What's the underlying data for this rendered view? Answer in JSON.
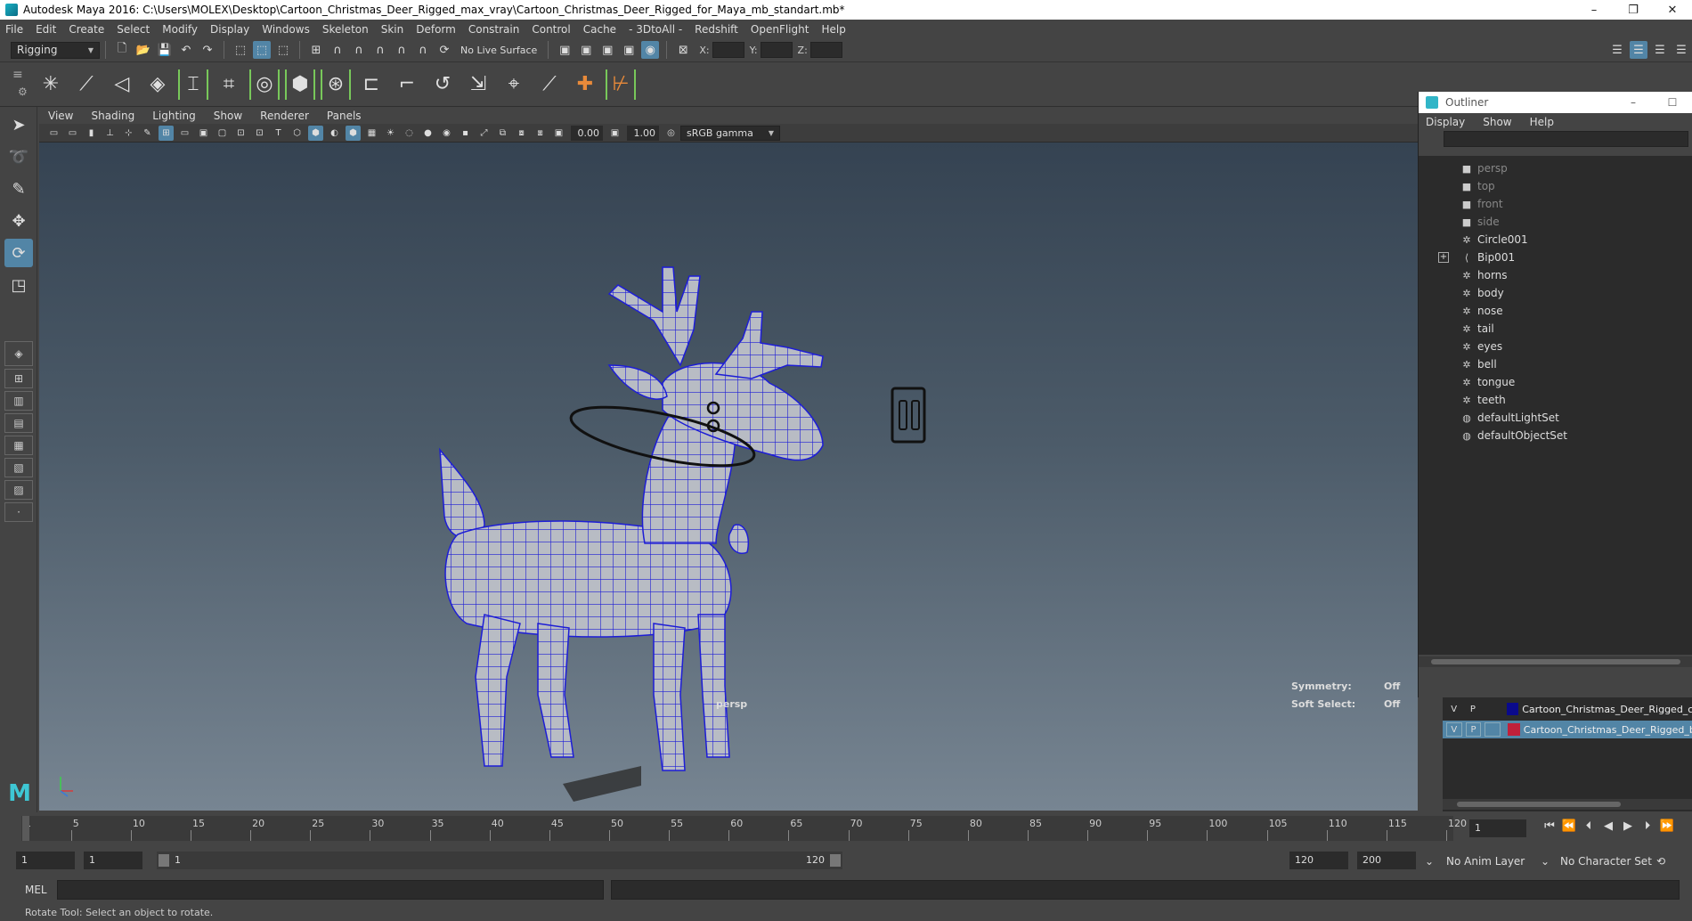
{
  "window": {
    "title": "Autodesk Maya 2016: C:\\Users\\MOLEX\\Desktop\\Cartoon_Christmas_Deer_Rigged_max_vray\\Cartoon_Christmas_Deer_Rigged_for_Maya_mb_standart.mb*",
    "minimize": "–",
    "restore": "❐",
    "close": "✕"
  },
  "menubar": [
    "File",
    "Edit",
    "Create",
    "Select",
    "Modify",
    "Display",
    "Windows",
    "Skeleton",
    "Skin",
    "Deform",
    "Constrain",
    "Control",
    "Cache",
    "- 3DtoAll -",
    "Redshift",
    "OpenFlight",
    "Help"
  ],
  "statusline": {
    "menuset": "Rigging",
    "live_surface": "No Live Surface",
    "x_label": "X:",
    "y_label": "Y:",
    "z_label": "Z:"
  },
  "viewport": {
    "menu": [
      "View",
      "Shading",
      "Lighting",
      "Show",
      "Renderer",
      "Panels"
    ],
    "exposure": "0.00",
    "gamma": "1.00",
    "color_space": "sRGB gamma",
    "camera": "persp",
    "hud": {
      "symmetry_label": "Symmetry:",
      "symmetry_value": "Off",
      "soft_select_label": "Soft Select:",
      "soft_select_value": "Off"
    }
  },
  "outliner": {
    "title": "Outliner",
    "menu": [
      "Display",
      "Show",
      "Help"
    ],
    "items": [
      {
        "label": "persp",
        "type": "camera"
      },
      {
        "label": "top",
        "type": "camera"
      },
      {
        "label": "front",
        "type": "camera"
      },
      {
        "label": "side",
        "type": "camera"
      },
      {
        "label": "Circle001",
        "type": "transform"
      },
      {
        "label": "Bip001",
        "type": "joint"
      },
      {
        "label": "horns",
        "type": "transform"
      },
      {
        "label": "body",
        "type": "transform"
      },
      {
        "label": "nose",
        "type": "transform"
      },
      {
        "label": "tail",
        "type": "transform"
      },
      {
        "label": "eyes",
        "type": "transform"
      },
      {
        "label": "bell",
        "type": "transform"
      },
      {
        "label": "tongue",
        "type": "transform"
      },
      {
        "label": "teeth",
        "type": "transform"
      },
      {
        "label": "defaultLightSet",
        "type": "set"
      },
      {
        "label": "defaultObjectSet",
        "type": "set"
      }
    ]
  },
  "layers": [
    {
      "v": "V",
      "p": "P",
      "color": "#0a0a8c",
      "name": "Cartoon_Christmas_Deer_Rigged_co"
    },
    {
      "v": "V",
      "p": "P",
      "color": "#c0203a",
      "name": "Cartoon_Christmas_Deer_Rigged_b"
    }
  ],
  "timeline": {
    "ticks": [
      "1",
      "5",
      "10",
      "15",
      "20",
      "25",
      "30",
      "35",
      "40",
      "45",
      "50",
      "55",
      "60",
      "65",
      "70",
      "75",
      "80",
      "85",
      "90",
      "95",
      "100",
      "105",
      "110",
      "115",
      "120"
    ],
    "current_frame": "1"
  },
  "range": {
    "start": "1",
    "playback_start": "1",
    "slider_start": "1",
    "slider_end": "120",
    "playback_end": "120",
    "end": "200",
    "anim_layer": "No Anim Layer",
    "character_set": "No Character Set"
  },
  "cmdline": {
    "mel_label": "MEL"
  },
  "helpline": "Rotate Tool: Select an object to rotate."
}
